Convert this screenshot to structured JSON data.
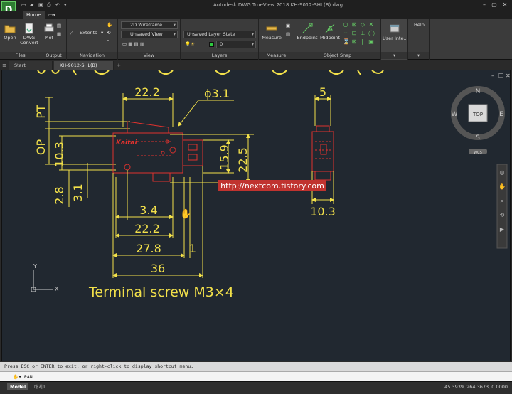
{
  "window": {
    "app_logo": "D",
    "title": "Autodesk DWG TrueView 2018    KH-9012-SHL(B).dwg",
    "min_btn": "–",
    "max_btn": "▢",
    "close_btn": "✕"
  },
  "ribbon": {
    "tab_home": "Home",
    "files": {
      "label": "Files",
      "open": "Open",
      "dwg_convert_1": "DWG",
      "dwg_convert_2": "Convert"
    },
    "output": {
      "label": "Output",
      "plot": "Plot"
    },
    "navigation": {
      "label": "Navigation",
      "extents": "Extents"
    },
    "view": {
      "label": "View",
      "visual_style": "2D Wireframe",
      "named_view": "Unsaved View"
    },
    "layers": {
      "label": "Layers",
      "layer_state": "Unsaved Layer State",
      "current_layer": "0"
    },
    "measure": {
      "label": "Measure",
      "measure_btn": "Measure"
    },
    "object_snap": {
      "label": "Object Snap",
      "endpoint": "Endpoint",
      "midpoint": "Midpoint"
    },
    "user_interface": {
      "label": "User Inte..."
    },
    "help": {
      "label": "Help"
    }
  },
  "doc_tabs": {
    "start": "Start",
    "drawing": "KH-9012-SHL(B)"
  },
  "viewcube": {
    "n": "N",
    "s": "S",
    "e": "E",
    "w": "W",
    "top": "TOP",
    "wcs": "WCS"
  },
  "drawing_text": {
    "dim_22_2_top": "22.2",
    "dim_phi": "ϕ3.1",
    "dim_5": "5",
    "label_pt": "PT",
    "label_op": "OP",
    "dim_10_3_left": "10.3",
    "dim_15_9": "15.9",
    "dim_22_5": "22.5",
    "dim_2_8": "2.8",
    "dim_3_1": "3.1",
    "dim_3_4": "3.4",
    "dim_22_2_bottom": "22.2",
    "dim_27_8": "27.8",
    "dim_1": "1",
    "dim_36": "36",
    "dim_10_3_right": "10.3",
    "brand": "Kaitai",
    "note": "Terminal screw M3×4",
    "watermark": "http://nextcom.tistory.com",
    "ucs_y": "Y",
    "ucs_x": "X"
  },
  "command": {
    "history": "Press ESC or ENTER to exit, or right-click to display shortcut menu.",
    "prompt": "PAN"
  },
  "status": {
    "model_tab": "Model",
    "layout_tab": "배치1",
    "coords": "45.3939, 264.3673, 0.0000"
  },
  "colors": {
    "dim_yellow": "#f2e04a",
    "part_red": "#e0322e",
    "drawing_bg": "#212830"
  }
}
